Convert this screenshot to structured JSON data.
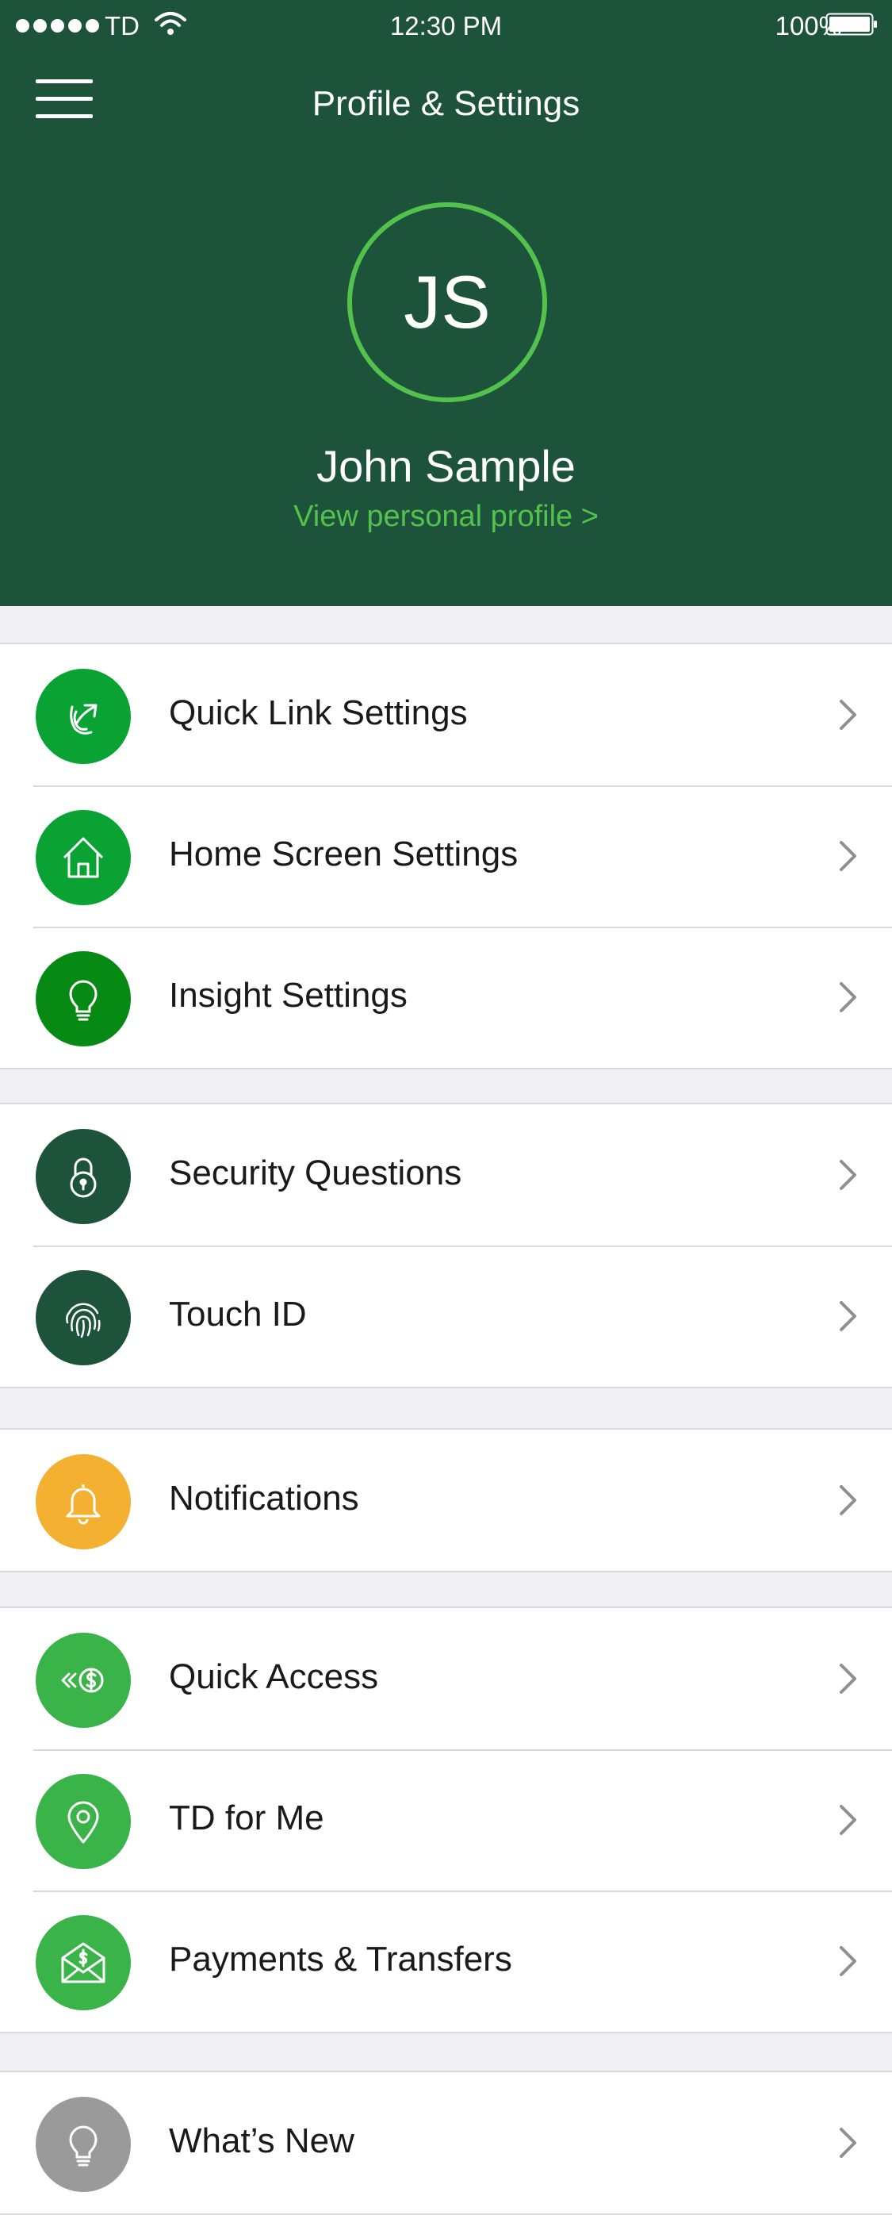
{
  "status_bar": {
    "carrier": "TD",
    "time": "12:30 PM",
    "battery": "100%"
  },
  "header": {
    "title": "Profile & Settings"
  },
  "profile": {
    "initials": "JS",
    "name": "John Sample",
    "link": "View personal profile >"
  },
  "colors": {
    "header_bg": "#1d533a",
    "accent_green": "#52c24d",
    "bright_green": "#06a432",
    "dark_green": "#1d533a",
    "notification_orange": "#f4b030",
    "grey": "#9a9a9a"
  },
  "groups": [
    {
      "items": [
        {
          "label": "Quick Link Settings",
          "icon": "link-arrow-icon",
          "color": "#0aa233"
        },
        {
          "label": "Home Screen Settings",
          "icon": "home-icon",
          "color": "#0aa233"
        },
        {
          "label": "Insight Settings",
          "icon": "lightbulb-icon",
          "color": "#068a14"
        }
      ]
    },
    {
      "items": [
        {
          "label": "Security Questions",
          "icon": "lock-icon",
          "color": "#1d533a"
        },
        {
          "label": "Touch ID",
          "icon": "fingerprint-icon",
          "color": "#1d533a"
        }
      ]
    },
    {
      "items": [
        {
          "label": "Notifications",
          "icon": "bell-icon",
          "color": "#f4b030"
        }
      ]
    },
    {
      "items": [
        {
          "label": "Quick Access",
          "icon": "quick-access-icon",
          "color": "#3ab348"
        },
        {
          "label": "TD for Me",
          "icon": "location-pin-icon",
          "color": "#3ab348"
        },
        {
          "label": "Payments & Transfers",
          "icon": "envelope-dollar-icon",
          "color": "#3ab348"
        }
      ]
    },
    {
      "items": [
        {
          "label": "What’s New",
          "icon": "lightbulb-icon",
          "color": "#9a9a9a"
        }
      ]
    }
  ]
}
